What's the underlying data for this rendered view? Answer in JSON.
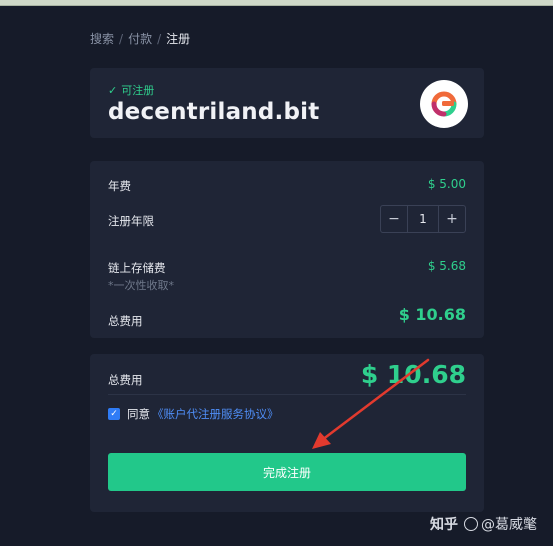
{
  "breadcrumb": [
    {
      "label": "搜索",
      "active": false
    },
    {
      "label": "付款",
      "active": false
    },
    {
      "label": "注册",
      "active": true
    }
  ],
  "domain": {
    "status": "可注册",
    "name": "decentriland.bit",
    "logo_icon": "bit-logo-icon"
  },
  "fees": {
    "annual_label": "年费",
    "annual_value": "$ 5.00",
    "years_label": "注册年限",
    "years_value": "1",
    "decrement": "−",
    "increment": "+",
    "storage_label": "链上存储费",
    "storage_value": "$ 5.68",
    "storage_note": "*一次性收取*",
    "total_label": "总费用",
    "total_value": "$ 10.68"
  },
  "summary": {
    "total_label": "总费用",
    "total_value": "$ 10.68",
    "agree_prefix": "同意",
    "agree_link": "《账户代注册服务协议》",
    "agree_checked": true,
    "submit_label": "完成注册"
  },
  "watermark": {
    "site": "知乎",
    "author": "@葛威氅"
  },
  "colors": {
    "accent_green": "#22c88a",
    "value_green": "#2fcf8d",
    "link_blue": "#4f8ef7",
    "arrow_red": "#e23a2e",
    "card_bg": "#1f2536",
    "page_bg": "#161b29"
  }
}
